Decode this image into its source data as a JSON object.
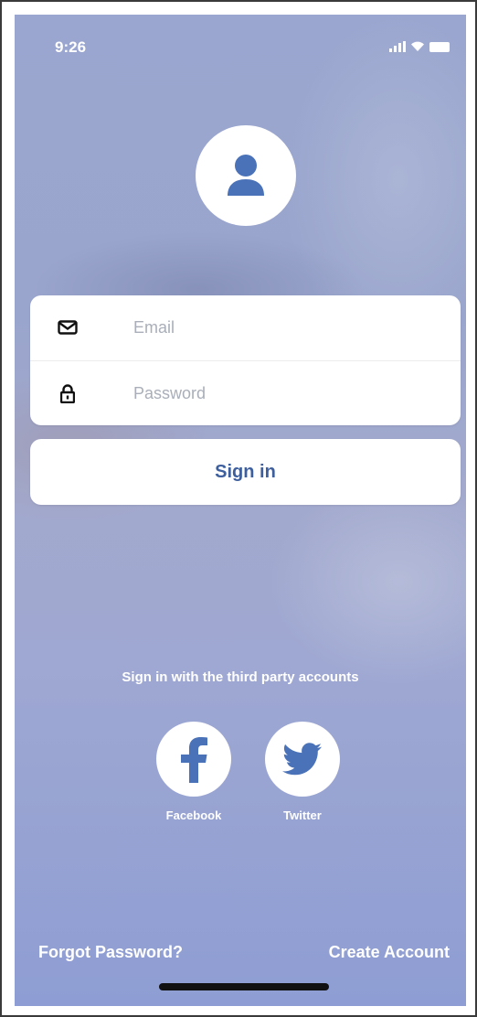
{
  "status_bar": {
    "time": "9:26",
    "icons": [
      "signal-icon",
      "wifi-icon",
      "battery-icon"
    ]
  },
  "avatar": {
    "icon": "user-icon"
  },
  "login_form": {
    "email": {
      "placeholder": "Email",
      "icon": "mail-icon"
    },
    "password": {
      "placeholder": "Password",
      "icon": "lock-icon"
    }
  },
  "sign_in_button": {
    "label": "Sign in"
  },
  "third_party": {
    "label": "Sign in with the third party accounts",
    "accounts": [
      {
        "name": "Facebook",
        "icon": "facebook-icon"
      },
      {
        "name": "Twitter",
        "icon": "twitter-icon"
      }
    ]
  },
  "footer": {
    "forgot_password": "Forgot Password?",
    "create_account": "Create Account"
  },
  "colors": {
    "background": "#9aa6cf",
    "accent": "#4a72b8",
    "button_text": "#3e5f9e",
    "placeholder": "#a9aeb8"
  }
}
